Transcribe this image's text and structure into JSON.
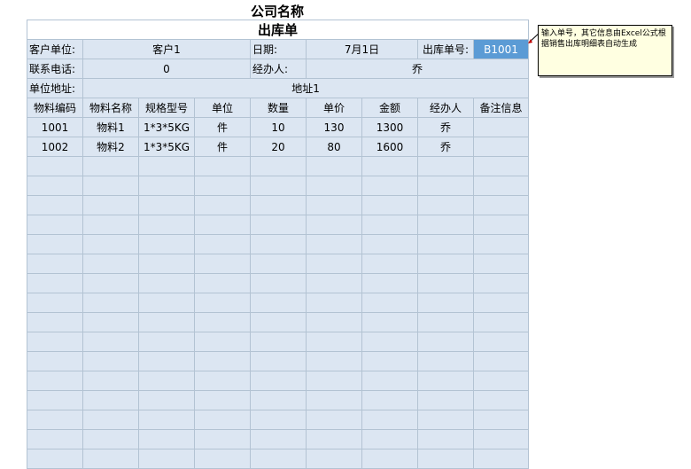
{
  "company_name": "公司名称",
  "form_title": "出库单",
  "header": {
    "customer_label": "客户单位:",
    "customer_value": "客户1",
    "date_label": "日期:",
    "date_value": "7月1日",
    "order_no_label": "出库单号:",
    "order_no_value": "B1001",
    "phone_label": "联系电话:",
    "phone_value": "0",
    "handler_label": "经办人:",
    "handler_value": "乔",
    "address_label": "单位地址:",
    "address_value": "地址1"
  },
  "columns": [
    "物料编码",
    "物料名称",
    "规格型号",
    "单位",
    "数量",
    "单价",
    "金额",
    "经办人",
    "备注信息"
  ],
  "rows": [
    [
      "1001",
      "物料1",
      "1*3*5KG",
      "件",
      "10",
      "130",
      "1300",
      "乔",
      ""
    ],
    [
      "1002",
      "物料2",
      "1*3*5KG",
      "件",
      "20",
      "80",
      "1600",
      "乔",
      ""
    ],
    [
      "",
      "",
      "",
      "",
      "",
      "",
      "",
      "",
      ""
    ],
    [
      "",
      "",
      "",
      "",
      "",
      "",
      "",
      "",
      ""
    ],
    [
      "",
      "",
      "",
      "",
      "",
      "",
      "",
      "",
      ""
    ],
    [
      "",
      "",
      "",
      "",
      "",
      "",
      "",
      "",
      ""
    ],
    [
      "",
      "",
      "",
      "",
      "",
      "",
      "",
      "",
      ""
    ],
    [
      "",
      "",
      "",
      "",
      "",
      "",
      "",
      "",
      ""
    ],
    [
      "",
      "",
      "",
      "",
      "",
      "",
      "",
      "",
      ""
    ],
    [
      "",
      "",
      "",
      "",
      "",
      "",
      "",
      "",
      ""
    ],
    [
      "",
      "",
      "",
      "",
      "",
      "",
      "",
      "",
      ""
    ],
    [
      "",
      "",
      "",
      "",
      "",
      "",
      "",
      "",
      ""
    ],
    [
      "",
      "",
      "",
      "",
      "",
      "",
      "",
      "",
      ""
    ],
    [
      "",
      "",
      "",
      "",
      "",
      "",
      "",
      "",
      ""
    ],
    [
      "",
      "",
      "",
      "",
      "",
      "",
      "",
      "",
      ""
    ],
    [
      "",
      "",
      "",
      "",
      "",
      "",
      "",
      "",
      ""
    ],
    [
      "",
      "",
      "",
      "",
      "",
      "",
      "",
      "",
      ""
    ],
    [
      "",
      "",
      "",
      "",
      "",
      "",
      "",
      "",
      ""
    ]
  ],
  "comment": "输入单号，其它信息由Excel公式根据销售出库明细表自动生成",
  "colors": {
    "cell_bg": "#dce6f2",
    "grid": "#b3c3d3",
    "input_bg": "#5b9bd5",
    "comment_bg": "#ffffe1"
  }
}
